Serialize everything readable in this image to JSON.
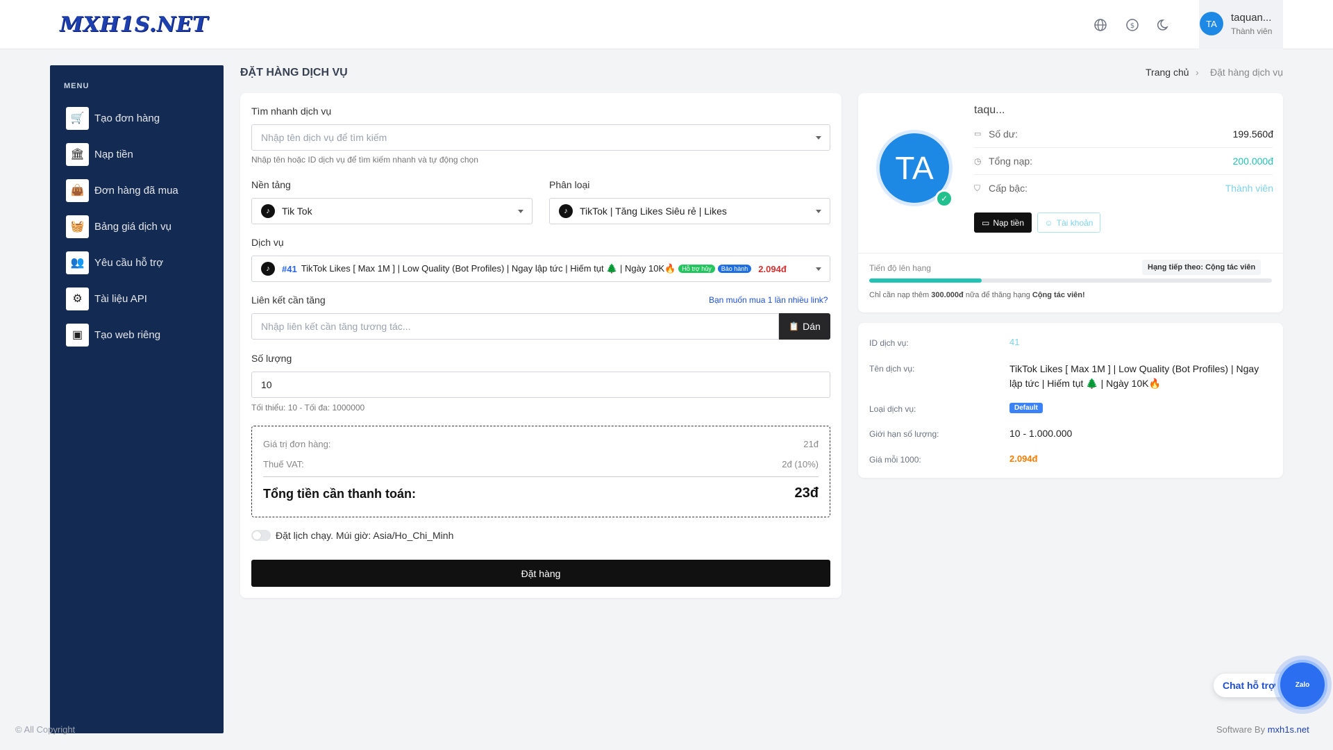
{
  "header": {
    "logo_text": "MXH1S.NET",
    "user_initials": "TA",
    "user_name": "taquan...",
    "user_role": "Thành viên"
  },
  "sidebar": {
    "menu_title": "MENU",
    "items": [
      {
        "label": "Tạo đơn hàng",
        "icon": "cart-icon"
      },
      {
        "label": "Nạp tiền",
        "icon": "bank-icon"
      },
      {
        "label": "Đơn hàng đã mua",
        "icon": "bag-icon"
      },
      {
        "label": "Bảng giá dịch vụ",
        "icon": "basket-icon"
      },
      {
        "label": "Yêu cầu hỗ trợ",
        "icon": "support-icon"
      },
      {
        "label": "Tài liệu API",
        "icon": "api-icon"
      },
      {
        "label": "Tạo web riêng",
        "icon": "web-icon"
      }
    ]
  },
  "page": {
    "title": "ĐẶT HÀNG DỊCH VỤ",
    "breadcrumb_home": "Trang chủ",
    "breadcrumb_sep": "›",
    "breadcrumb_current": "Đặt hàng dịch vụ"
  },
  "form": {
    "search_label": "Tìm nhanh dịch vụ",
    "search_placeholder": "Nhập tên dịch vụ để tìm kiếm",
    "search_hint": "Nhập tên hoặc ID dịch vụ để tìm kiếm nhanh và tự động chọn",
    "platform_label": "Nền tảng",
    "platform_value": "Tik Tok",
    "category_label": "Phân loại",
    "category_value": "TikTok | Tăng Likes Siêu rẻ | Likes",
    "service_label": "Dịch vụ",
    "service_id": "#41",
    "service_name": "TikTok Likes [ Max 1M ] | Low Quality (Bot Profiles) | Ngay lập tức | Hiếm tụt 🌲 | Ngày 10K🔥",
    "badge_cancel": "Hỗ trợ hủy",
    "badge_warranty": "Bảo hành",
    "service_price": "2.094đ",
    "link_label": "Liên kết cần tăng",
    "link_multi": "Bạn muốn mua 1 lần nhiều link?",
    "link_placeholder": "Nhập liên kết cần tăng tương tác...",
    "paste_label": "Dán",
    "quantity_label": "Số lượng",
    "quantity_value": "10",
    "quantity_hint": "Tối thiểu: 10 - Tối đa: 1000000",
    "order_value_label": "Giá trị đơn hàng:",
    "order_value": "21đ",
    "vat_label": "Thuế VAT:",
    "vat_value": "2đ (10%)",
    "total_label": "Tổng tiền cần thanh toán:",
    "total_value": "23đ",
    "schedule_label": "Đặt lịch chạy. Múi giờ: Asia/Ho_Chi_Minh",
    "submit_label": "Đặt hàng"
  },
  "profile": {
    "initials": "TA",
    "name": "taqu...",
    "balance_label": "Số dư:",
    "balance_value": "199.560đ",
    "deposit_label": "Tổng nạp:",
    "deposit_value": "200.000đ",
    "level_label": "Cấp bậc:",
    "level_value": "Thành viên",
    "topup_btn": "Nạp tiền",
    "account_btn": "Tài khoản",
    "progress_label": "Tiến độ lên hạng",
    "next_level": "Hạng tiếp theo: Cộng tác viên",
    "progress_fraction": 0.28,
    "progress_note_pre": "Chỉ cần nạp thêm ",
    "progress_note_amount": "300.000đ",
    "progress_note_mid": " nữa để thăng hạng ",
    "progress_note_rank": "Cộng tác viên!"
  },
  "service_info": {
    "id_label": "ID dịch vụ:",
    "id_value": "41",
    "name_label": "Tên dịch vụ:",
    "name_value": "TikTok Likes [ Max 1M ] | Low Quality (Bot Profiles) | Ngay lập tức | Hiếm tụt 🌲 | Ngày 10K🔥",
    "type_label": "Loại dịch vụ:",
    "type_value": "Default",
    "limit_label": "Giới hạn số lượng:",
    "limit_value": "10 - 1.000.000",
    "price_label": "Giá mỗi 1000:",
    "price_value": "2.094đ"
  },
  "footer": {
    "left": "© All Copyright",
    "right_prefix": "Software By ",
    "right_link": "mxh1s.net"
  },
  "chat": {
    "label": "Chat hỗ trợ",
    "button": "Zalo"
  },
  "colors": {
    "sidebar_bg": "#132a52",
    "accent_blue": "#1e88e5",
    "teal": "#22c3b5",
    "price_red": "#d32f2f",
    "price_orange": "#f57c00"
  }
}
